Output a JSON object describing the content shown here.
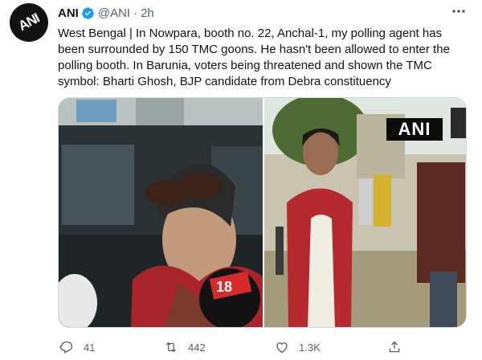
{
  "tweet": {
    "author_name": "ANI",
    "handle": "@ANI",
    "separator": "·",
    "time": "2h",
    "verified_icon": "verified-badge-icon",
    "more_icon": "more-options-icon",
    "avatar_text": "ANI",
    "text": "West Bengal | In Nowpara, booth no. 22, Anchal-1, my polling agent has been surrounded by 150 TMC goons. He hasn't been allowed to enter the polling booth. In Barunia, voters being threatened and shown the TMC symbol: Bharti Ghosh, BJP candidate from Debra constituency",
    "media": {
      "image_2_watermark": "ANI",
      "image_1_mic_number": "18"
    },
    "actions": {
      "reply_count": "41",
      "retweet_count": "442",
      "like_count": "1.3K"
    }
  },
  "colors": {
    "verified": "#1d9bf0",
    "secondary_text": "#536471",
    "primary_text": "#0f1419"
  }
}
